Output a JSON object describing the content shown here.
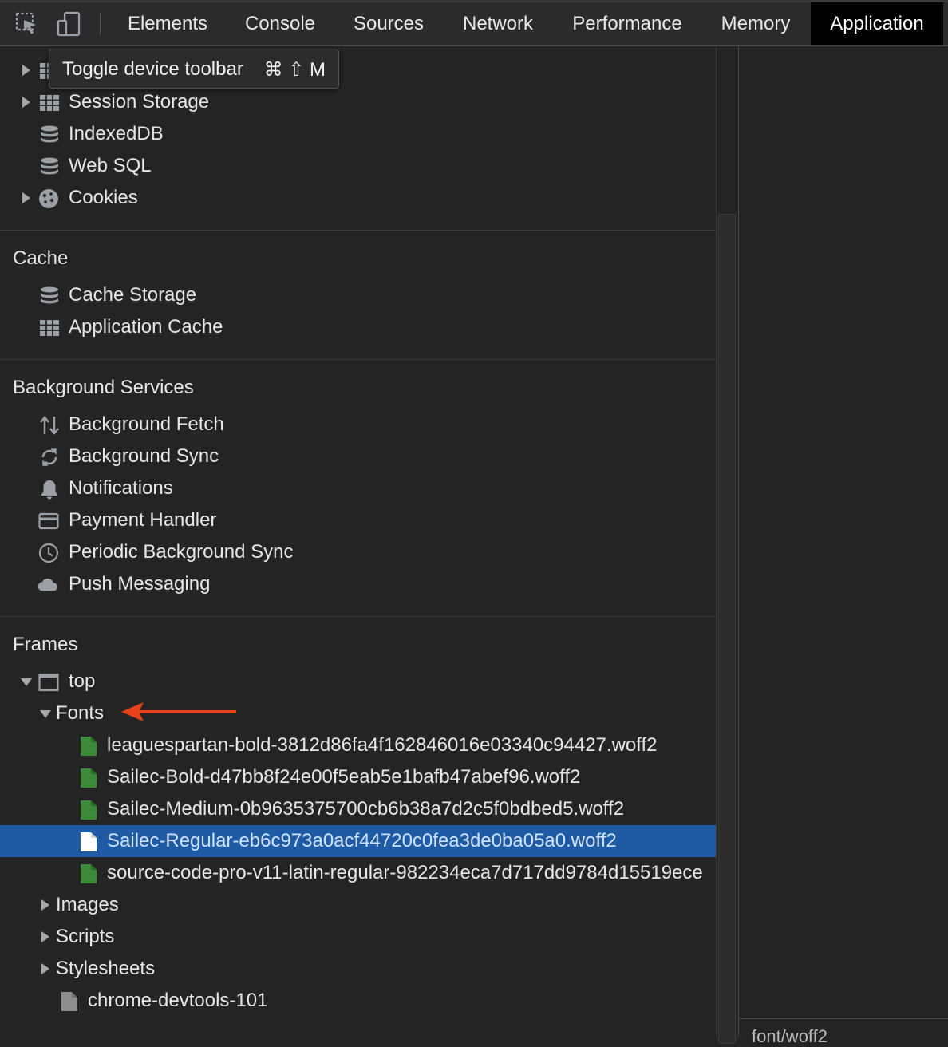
{
  "toolbar": {
    "tabs": [
      {
        "label": "Elements"
      },
      {
        "label": "Console"
      },
      {
        "label": "Sources"
      },
      {
        "label": "Network"
      },
      {
        "label": "Performance"
      },
      {
        "label": "Memory"
      },
      {
        "label": "Application",
        "active": true
      }
    ],
    "icons": [
      "inspect-element-icon",
      "device-toolbar-icon"
    ]
  },
  "tooltip": {
    "text": "Toggle device toolbar",
    "shortcut": "⌘ ⇧ M"
  },
  "storage": {
    "items": [
      {
        "label": "Session Storage",
        "icon": "table-icon"
      },
      {
        "label": "IndexedDB",
        "icon": "database-icon"
      },
      {
        "label": "Web SQL",
        "icon": "database-icon"
      },
      {
        "label": "Cookies",
        "icon": "cookie-icon"
      }
    ]
  },
  "cache": {
    "title": "Cache",
    "items": [
      {
        "label": "Cache Storage",
        "icon": "database-icon"
      },
      {
        "label": "Application Cache",
        "icon": "table-icon"
      }
    ]
  },
  "background_services": {
    "title": "Background Services",
    "items": [
      {
        "label": "Background Fetch",
        "icon": "up-down-arrows-icon"
      },
      {
        "label": "Background Sync",
        "icon": "sync-icon"
      },
      {
        "label": "Notifications",
        "icon": "bell-icon"
      },
      {
        "label": "Payment Handler",
        "icon": "credit-card-icon"
      },
      {
        "label": "Periodic Background Sync",
        "icon": "clock-icon"
      },
      {
        "label": "Push Messaging",
        "icon": "cloud-icon"
      }
    ]
  },
  "frames": {
    "title": "Frames",
    "top_label": "top",
    "fonts_label": "Fonts",
    "font_files": [
      "leaguespartan-bold-3812d86fa4f162846016e03340c94427.woff2",
      "Sailec-Bold-d47bb8f24e00f5eab5e1bafb47abef96.woff2",
      "Sailec-Medium-0b9635375700cb6b38a7d2c5f0bdbed5.woff2",
      "Sailec-Regular-eb6c973a0acf44720c0fea3de0ba05a0.woff2",
      "source-code-pro-v11-latin-regular-982234eca7d717dd9784d15519ece"
    ],
    "selected_font_index": 3,
    "images_label": "Images",
    "scripts_label": "Scripts",
    "stylesheets_label": "Stylesheets",
    "document_label": "chrome-devtools-101"
  },
  "right_pane": {
    "peek_text": "font/woff2"
  },
  "colors": {
    "accent_selected": "#1e5ba4",
    "annotation_arrow": "#e8421c",
    "font_file_icon": "#3c8a3a"
  }
}
